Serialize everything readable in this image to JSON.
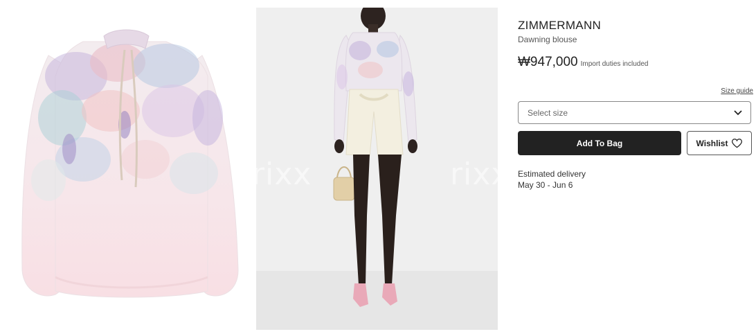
{
  "product": {
    "brand": "ZIMMERMANN",
    "name": "Dawning blouse",
    "price": "₩947,000",
    "duties_note": "Import duties included"
  },
  "size": {
    "guide_label": "Size guide",
    "placeholder": "Select size"
  },
  "actions": {
    "add_to_bag": "Add To Bag",
    "wishlist": "Wishlist"
  },
  "delivery": {
    "label": "Estimated delivery",
    "dates": "May 30 - Jun 6"
  },
  "gallery": {
    "watermark": "rixx"
  },
  "icons": {
    "select": "chevron-down-icon",
    "wishlist": "heart-icon"
  },
  "colors": {
    "primary_button": "#222222",
    "image_background": "#efefef"
  }
}
